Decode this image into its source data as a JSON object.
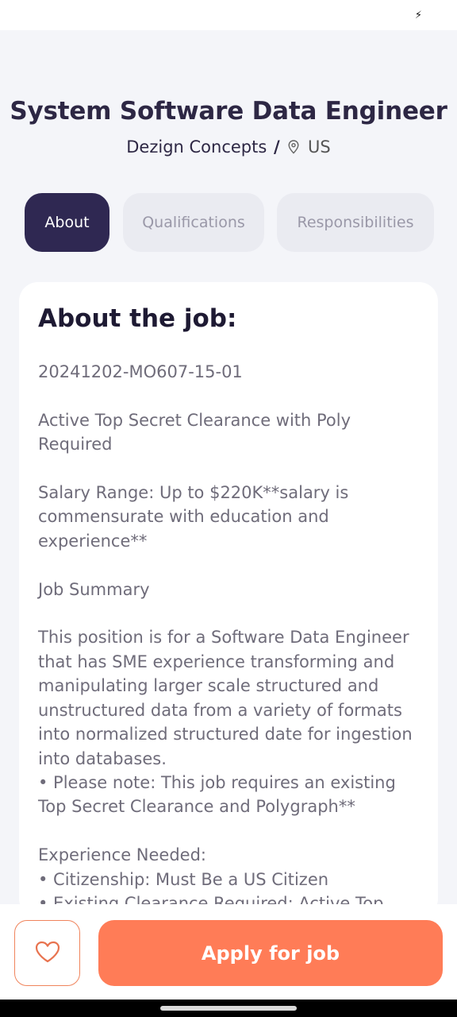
{
  "job": {
    "title": "System Software Data Engineer",
    "company": "Dezign Concepts",
    "separator": "/",
    "location": "US"
  },
  "tabs": [
    {
      "label": "About",
      "active": true
    },
    {
      "label": "Qualifications",
      "active": false
    },
    {
      "label": "Responsibilities",
      "active": false
    }
  ],
  "about": {
    "heading": "About the job:",
    "body": "20241202-MO607-15-01\n\nActive Top Secret Clearance with Poly Required\n\nSalary Range: Up to $220K**salary is commensurate with education and experience**\n\nJob Summary\n\nThis position is for a Software Data Engineer that has SME experience transforming and manipulating larger scale structured and unstructured data from a variety of formats into normalized structured date for ingestion into databases.\n• Please note: This job requires an existing Top Secret Clearance and Polygraph**\n\nExperience Needed:\n• Citizenship: Must Be a US Citizen\n• Existing Clearance Required: Active Top"
  },
  "actions": {
    "apply_label": "Apply for job",
    "favorite_icon": "heart-icon"
  },
  "colors": {
    "primary_dark": "#2f2852",
    "accent": "#ff7c57",
    "background": "#f4f5f9"
  }
}
